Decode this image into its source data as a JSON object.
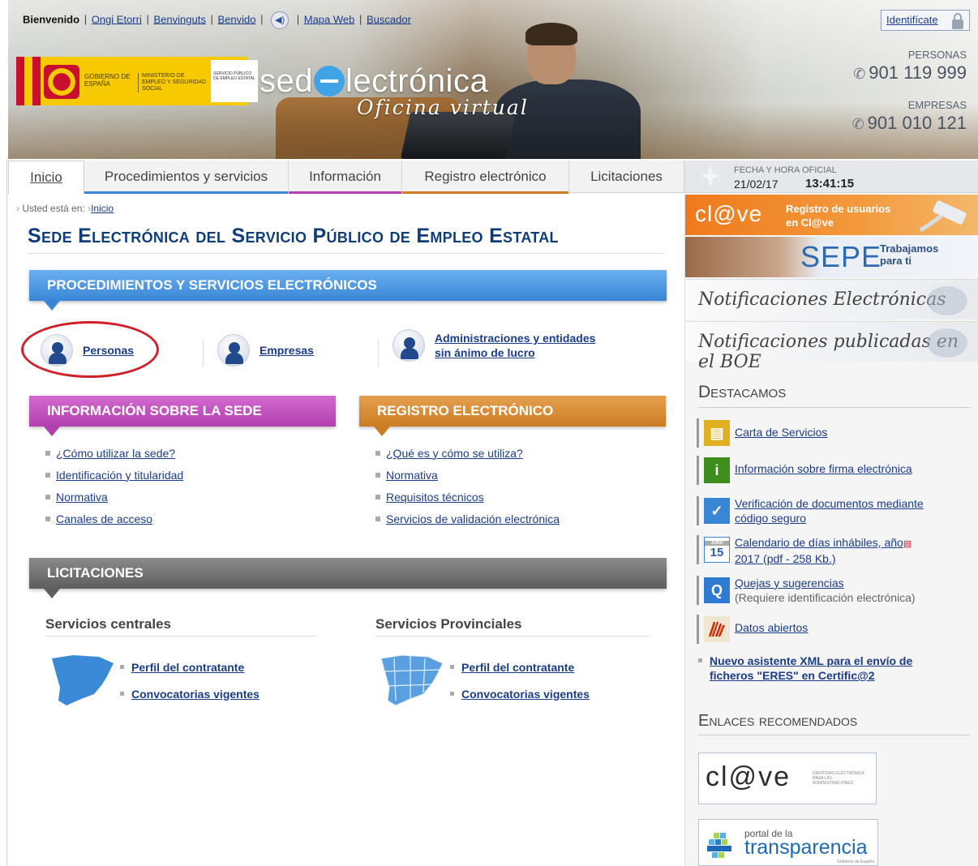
{
  "header": {
    "lang_links": [
      "Bienvenido",
      "Ongi Etorri",
      "Benvinguts",
      "Benvido"
    ],
    "mapa_web": "Mapa Web",
    "buscador": "Buscador",
    "identificate": "Identifícate",
    "logo_gobierno": "GOBIERNO DE ESPAÑA",
    "logo_ministerio": "MINISTERIO DE EMPLEO Y SEGURIDAD SOCIAL",
    "logo_sepe": "SERVICIO PÚBLICO DE EMPLEO ESTATAL",
    "logo_sede_pre": "sed",
    "logo_sede_post": "lectrónica",
    "logo_subtitle": "Oficina virtual",
    "personas_label": "PERSONAS",
    "personas_phone": "901 119 999",
    "empresas_label": "EMPRESAS",
    "empresas_phone": "901 010 121"
  },
  "nav": {
    "tabs": [
      {
        "label": "Inicio",
        "accent": ""
      },
      {
        "label": "Procedimientos y servicios",
        "accent": "#3a86d6"
      },
      {
        "label": "Información",
        "accent": "#b23fae"
      },
      {
        "label": "Registro electrónico",
        "accent": "#cc7d22"
      },
      {
        "label": "Licitaciones",
        "accent": ""
      }
    ]
  },
  "breadcrumb": {
    "prefix": "Usted está en:",
    "current": "Inicio"
  },
  "page_title": "Sede Electrónica del Servicio Público de Empleo Estatal",
  "procedimientos": {
    "heading": "PROCEDIMIENTOS Y SERVICIOS ELECTRÓNICOS",
    "personas": "Personas",
    "empresas": "Empresas",
    "admin_line1": "Administraciones y entidades",
    "admin_line2": "sin ánimo de lucro"
  },
  "info_sede": {
    "heading": "INFORMACIÓN SOBRE LA SEDE",
    "links": [
      "¿Cómo utilizar la sede?",
      "Identificación y titularidad",
      "Normativa",
      "Canales de acceso"
    ]
  },
  "registro": {
    "heading": "REGISTRO ELECTRÓNICO",
    "links": [
      "¿Qué es y cómo se utiliza?",
      "Normativa",
      "Requisitos técnicos",
      "Servicios de validación electrónica"
    ]
  },
  "licitaciones": {
    "heading": "LICITACIONES",
    "centrales": {
      "title": "Servicios centrales",
      "links": [
        "Perfil del contratante",
        "Convocatorias vigentes"
      ]
    },
    "provinciales": {
      "title": "Servicios Provinciales",
      "links": [
        "Perfil del contratante",
        "Convocatorias vigentes"
      ]
    }
  },
  "sidebar": {
    "fecha_label": "FECHA Y HORA OFICIAL",
    "fecha": "21/02/17",
    "hora": "13:41:15",
    "clave_word": "cl@ve",
    "clave_line1": "Registro de usuarios",
    "clave_line2": "en Cl@ve",
    "sepe_word": "SEPE",
    "sepe_line1": "Trabajamos",
    "sepe_line2": "para ti",
    "notif": "Notificaciones Electrónicas",
    "boe": "Notificaciones publicadas en el BOE",
    "destacamos": "Destacamos",
    "items": [
      {
        "line1": "Carta de Servicios",
        "line2": "",
        "sub": "",
        "icon": "document-icon",
        "color": "#e0b020"
      },
      {
        "line1": "Información sobre firma electrónica",
        "line2": "",
        "sub": "",
        "icon": "info-icon",
        "color": "#3e8e1e"
      },
      {
        "line1": "Verificación de documentos mediante",
        "line2": "código seguro",
        "sub": "",
        "icon": "checkmark-icon",
        "color": "#3a86d6"
      },
      {
        "line1": "Calendario de días inhábiles, año",
        "line2": "2017 (pdf - 258 Kb.)",
        "sub": "",
        "icon": "calendar-icon",
        "color": "#ffffff"
      },
      {
        "line1": "Quejas y sugerencias",
        "line2": "",
        "sub": "(Requiere identificación electrónica)",
        "icon": "question-icon",
        "color": "#2f7bd1"
      },
      {
        "line1": "Datos abiertos",
        "line2": "",
        "sub": "",
        "icon": "open-data-icon",
        "color": "#efe6d0"
      }
    ],
    "calendar_day": "15",
    "calendar_month": "JUNIO",
    "nuevo_line1": "Nuevo asistente XML para el envío de",
    "nuevo_line2": "ficheros \"ERES\" en Certific@2",
    "enlaces": "Enlaces recomendados",
    "clave_link": "cl@ve",
    "clave_link_sub": "IDENTIDAD ELECTRÓNICA PARA LAS ADMINISTRACIONES",
    "transp_pre": "portal de la",
    "transp_word": "transparencia",
    "transp_sub": "Gobierno de España"
  }
}
